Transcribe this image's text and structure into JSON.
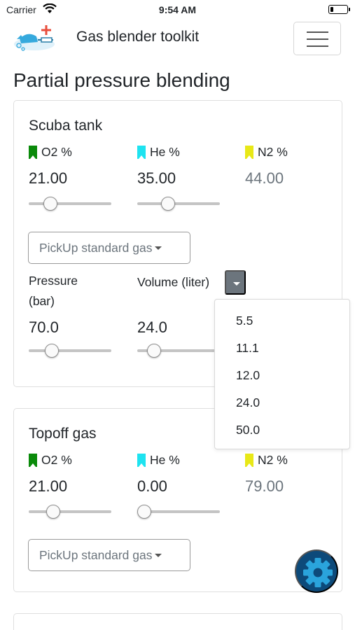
{
  "status": {
    "carrier": "Carrier",
    "time": "9:54 AM",
    "battery_level": 0.2
  },
  "navbar": {
    "title": "Gas blender toolkit",
    "logo_icon": "blender-logo-icon",
    "menu_icon": "hamburger-menu-icon"
  },
  "page": {
    "title": "Partial pressure blending"
  },
  "scuba": {
    "title": "Scuba tank",
    "o2": {
      "label": "O2 %",
      "value": "21.00",
      "slider": 0.21,
      "color": "#0a8a0a"
    },
    "he": {
      "label": "He %",
      "value": "35.00",
      "slider": 0.35,
      "color": "#1ee3f0"
    },
    "n2": {
      "label": "N2 %",
      "value": "44.00",
      "color": "#e8e817"
    },
    "pickup_label": "PickUp standard gas",
    "pressure_label": "Pressure",
    "pressure_unit": "(bar)",
    "pressure_value": "70.0",
    "pressure_slider": 0.23,
    "volume_label": "Volume (liter)",
    "volume_value": "24.0",
    "volume_slider": 0.14
  },
  "volume_options": [
    "5.5",
    "11.1",
    "12.0",
    "24.0",
    "50.0"
  ],
  "topoff": {
    "title": "Topoff gas",
    "o2": {
      "label": "O2 %",
      "value": "21.00",
      "slider": 0.26
    },
    "he": {
      "label": "He %",
      "value": "0.00",
      "slider": 0.0
    },
    "n2": {
      "label": "N2 %",
      "value": "79.00"
    },
    "pickup_label": "PickUp standard gas"
  },
  "fab_icon": "gear-icon"
}
